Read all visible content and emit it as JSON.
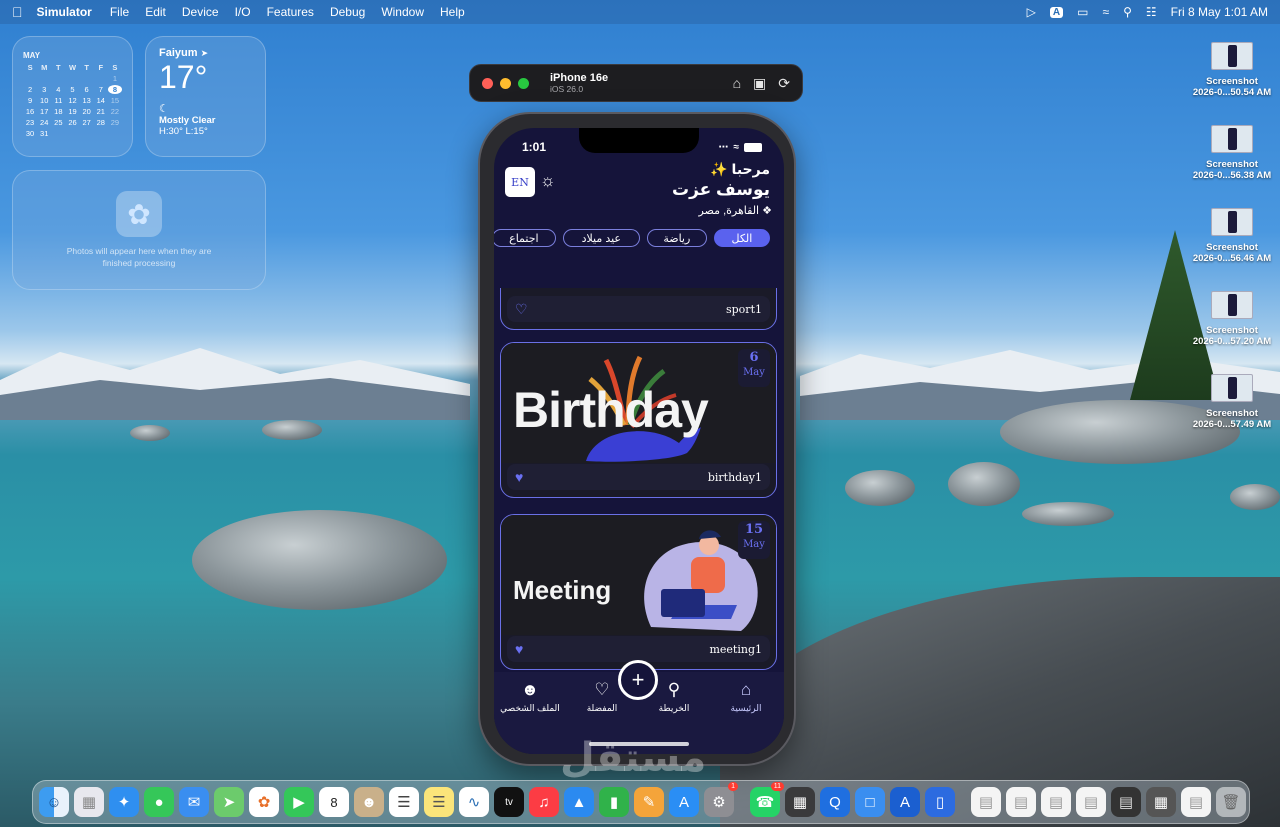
{
  "menubar": {
    "app": "Simulator",
    "items": [
      "File",
      "Edit",
      "Device",
      "I/O",
      "Features",
      "Debug",
      "Window",
      "Help"
    ],
    "input_badge": "A",
    "datetime": "Fri 8 May  1:01 AM"
  },
  "calendar_widget": {
    "month": "MAY",
    "weekdays": [
      "S",
      "M",
      "T",
      "W",
      "T",
      "F",
      "S"
    ],
    "rows": [
      [
        "",
        "",
        "",
        "",
        "",
        "",
        "1"
      ],
      [
        "2",
        "3",
        "4",
        "5",
        "6",
        "7",
        "8"
      ],
      [
        "9",
        "10",
        "11",
        "12",
        "13",
        "14",
        "15"
      ],
      [
        "16",
        "17",
        "18",
        "19",
        "20",
        "21",
        "22"
      ],
      [
        "23",
        "24",
        "25",
        "26",
        "27",
        "28",
        "29"
      ],
      [
        "30",
        "31",
        "",
        "",
        "",
        "",
        ""
      ]
    ],
    "today": "8"
  },
  "weather_widget": {
    "city": "Faiyum",
    "temp": "17°",
    "condition": "Mostly Clear",
    "hilo": "H:30° L:15°"
  },
  "photos_widget": {
    "message": "Photos will appear here when they are finished processing"
  },
  "desktop_files": [
    {
      "line1": "Screenshot",
      "line2": "2026-0...50.54 AM"
    },
    {
      "line1": "Screenshot",
      "line2": "2026-0...56.38 AM"
    },
    {
      "line1": "Screenshot",
      "line2": "2026-0...56.46 AM"
    },
    {
      "line1": "Screenshot",
      "line2": "2026-0...57.20 AM"
    },
    {
      "line1": "Screenshot",
      "line2": "2026-0...57.49 AM"
    }
  ],
  "simulator": {
    "device": "iPhone 16e",
    "os": "iOS 26.0"
  },
  "phone": {
    "time": "1:01",
    "lang_button": "EN",
    "greeting": "مرحبا ✨",
    "user_name": "يوسف عزت",
    "location": "القاهرة, مصر",
    "chips": [
      {
        "label": "الكل",
        "active": true
      },
      {
        "label": "رياضة",
        "active": false
      },
      {
        "label": "عيد ميلاد",
        "active": false
      },
      {
        "label": "اجتماع",
        "active": false
      }
    ],
    "cards": [
      {
        "name": "sport1",
        "banner_text": ""
      },
      {
        "name": "birthday1",
        "banner_text": "Birthday",
        "day": "6",
        "month": "May"
      },
      {
        "name": "meeting1",
        "banner_text": "Meeting",
        "day": "15",
        "month": "May"
      }
    ],
    "tabs": {
      "profile": "الملف الشخصي",
      "favorites": "المفضلة",
      "add": "+",
      "map": "الخريطة",
      "home": "الرئيسية"
    }
  },
  "watermark": "مستقل",
  "dock": {
    "system_prefs_badge": "1",
    "whatsapp_badge": "11",
    "calendar_day": "8"
  },
  "colors": {
    "app_bg": "#15143a",
    "accent": "#5a62ee",
    "card_border": "#6a70e6"
  }
}
